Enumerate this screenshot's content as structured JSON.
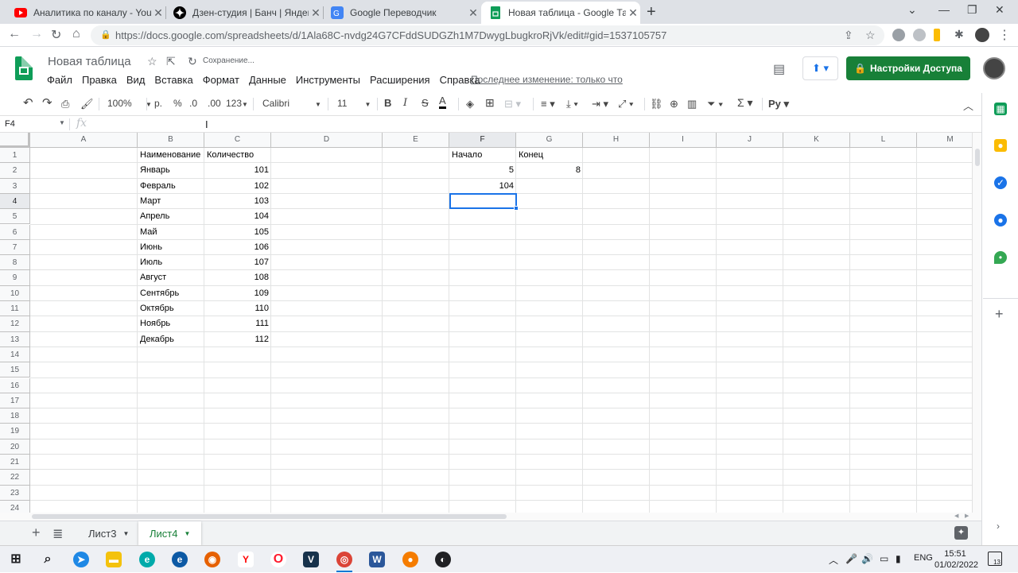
{
  "browser": {
    "tabs": [
      {
        "label": "Аналитика по каналу - YouTube",
        "favicon": "youtube-icon",
        "color": "#ff0000"
      },
      {
        "label": "Дзен-студия | Банч | Яндекс Дзен",
        "favicon": "dzen-icon",
        "color": "#000000"
      },
      {
        "label": "Google Переводчик",
        "favicon": "translate-icon",
        "color": "#4285f4"
      },
      {
        "label": "Новая таблица - Google Таблицы",
        "favicon": "sheets-icon",
        "color": "#0f9d58"
      }
    ],
    "url": "https://docs.google.com/spreadsheets/d/1Ala68C-nvdg24G7CFddSUDGZh1M7DwygLbugkroRjVk/edit#gid=1537105757"
  },
  "app": {
    "title": "Новая таблица",
    "saving": "Сохранение...",
    "menu": [
      "Файл",
      "Правка",
      "Вид",
      "Вставка",
      "Формат",
      "Данные",
      "Инструменты",
      "Расширения",
      "Справка"
    ],
    "last_edit": "Последнее изменение: только что",
    "share_label": "Настройки Доступа"
  },
  "toolbar": {
    "zoom": "100%",
    "currency": "р.",
    "percent": "%",
    "dec_decrease": ".0",
    "dec_increase": ".00",
    "format_more": "123",
    "font": "Calibri",
    "font_size": "11",
    "bold": "B",
    "italic": "I",
    "strike": "S",
    "text_color": "A"
  },
  "formula_bar": {
    "cell_ref": "F4",
    "fx": "fx",
    "value": ""
  },
  "grid": {
    "columns": [
      "A",
      "B",
      "C",
      "D",
      "E",
      "F",
      "G",
      "H",
      "I",
      "J",
      "K",
      "L",
      "M"
    ],
    "selected_column": "F",
    "selected_row": 4,
    "row_count": 25,
    "cells": {
      "B1": "Наименование",
      "C1": "Количество",
      "F1": "Начало",
      "G1": "Конец",
      "B2": "Январь",
      "C2": "101",
      "F2": "5",
      "G2": "8",
      "B3": "Февраль",
      "C3": "102",
      "F3": "104",
      "B4": "Март",
      "C4": "103",
      "B5": "Апрель",
      "C5": "104",
      "B6": "Май",
      "C6": "105",
      "B7": "Июнь",
      "C7": "106",
      "B8": "Июль",
      "C8": "107",
      "B9": "Август",
      "C9": "108",
      "B10": "Сентябрь",
      "C10": "109",
      "B11": "Октябрь",
      "C11": "110",
      "B12": "Ноябрь",
      "C12": "111",
      "B13": "Декабрь",
      "C13": "112"
    },
    "numeric_cells": [
      "C2",
      "C3",
      "C4",
      "C5",
      "C6",
      "C7",
      "C8",
      "C9",
      "C10",
      "C11",
      "C12",
      "C13",
      "F2",
      "G2",
      "F3"
    ]
  },
  "sheets": [
    {
      "label": "Лист3",
      "active": false
    },
    {
      "label": "Лист4",
      "active": true
    }
  ],
  "taskbar": {
    "lang": "ENG",
    "time": "15:51",
    "date": "01/02/2022",
    "notifications": "13"
  },
  "colors": {
    "accent": "#1a73e8",
    "share_green": "#188038",
    "sheets_green": "#0f9d58"
  }
}
